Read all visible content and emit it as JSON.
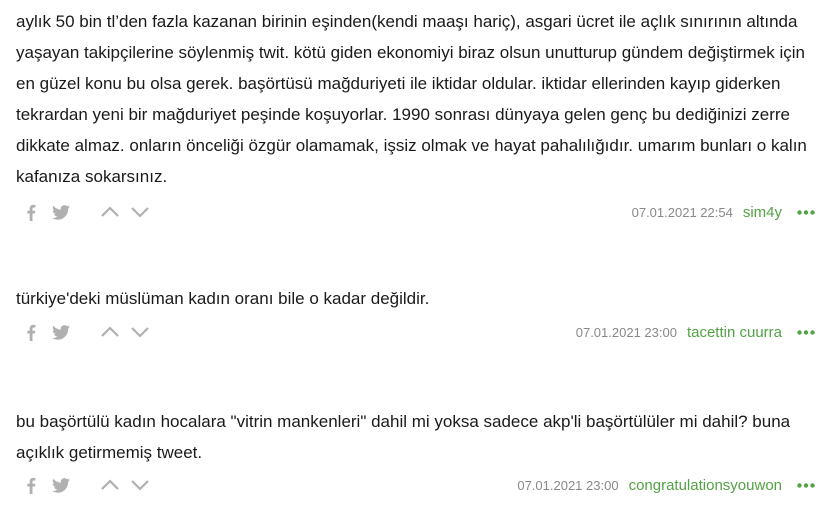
{
  "entries": [
    {
      "text": "aylık 50 bin tl’den fazla kazanan birinin eşinden(kendi maaşı hariç), asgari ücret ile açlık sınırının altında yaşayan takipçilerine söylenmiş twit. kötü giden ekonomiyi biraz olsun unutturup gündem değiştirmek için en güzel konu bu olsa gerek. başörtüsü mağduriyeti ile iktidar oldular. iktidar ellerinden kayıp giderken tekrardan yeni bir mağduriyet peşinde koşuyorlar. 1990 sonrası dünyaya gelen genç bu dediğinizi zerre dikkate almaz. onların önceliği özgür olamamak, işsiz olmak ve hayat pahalılığıdır. umarım bunları o kalın kafanıza sokarsınız.",
      "date": "07.01.2021 22:54",
      "author": "sim4y"
    },
    {
      "text": "türkiye'deki müslüman kadın oranı bile o kadar değildir.",
      "date": "07.01.2021 23:00",
      "author": "tacettin cuurra"
    },
    {
      "text": "bu başörtülü kadın hocalara \"vitrin mankenleri\" dahil mi yoksa sadece akp'li başörtülüler mi dahil? buna açıklık getirmemiş tweet.",
      "date": "07.01.2021 23:00",
      "author": "congratulationsyouwon"
    }
  ],
  "icons": {
    "share_facebook": "facebook-icon",
    "share_twitter": "twitter-icon",
    "upvote": "chevron-up-icon",
    "downvote": "chevron-down-icon",
    "more": "more-dots-icon"
  },
  "colors": {
    "author": "#53a245",
    "more": "#53a245",
    "icons": "#b0b0b0",
    "date": "#888888"
  }
}
